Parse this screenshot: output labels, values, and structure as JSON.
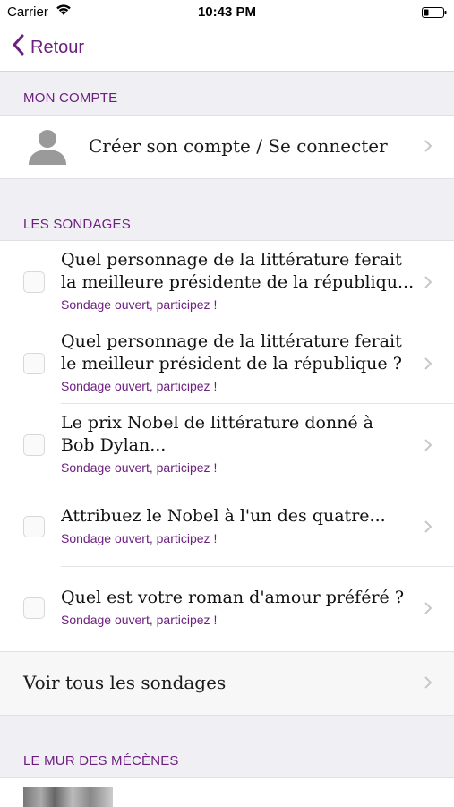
{
  "status_bar": {
    "carrier": "Carrier",
    "time": "10:43 PM",
    "wifi_icon": "wifi-icon",
    "battery_icon": "battery-icon"
  },
  "nav": {
    "back_label": "Retour",
    "back_icon": "chevron-left-icon"
  },
  "account_section": {
    "header": "MON COMPTE",
    "row_label": "Créer son compte / Se connecter",
    "avatar_icon": "user-silhouette-icon"
  },
  "polls_section": {
    "header": "LES SONDAGES",
    "items": [
      {
        "title_lines": [
          "Quel personnage de la littérature ferait",
          "la meilleure présidente de la républiqu..."
        ],
        "status": "Sondage ouvert, participez !"
      },
      {
        "title_lines": [
          "Quel personnage de la littérature ferait",
          "le meilleur président de la république ?"
        ],
        "status": "Sondage ouvert, participez !"
      },
      {
        "title_lines": [
          "Le prix Nobel de littérature donné à",
          "Bob Dylan..."
        ],
        "status": "Sondage ouvert, participez !"
      },
      {
        "title_lines": [
          "Attribuez le Nobel à l'un des quatre..."
        ],
        "status": "Sondage ouvert, participez !"
      },
      {
        "title_lines": [
          "Quel est votre roman d'amour préféré ?"
        ],
        "status": "Sondage ouvert, participez !"
      }
    ],
    "see_all_label": "Voir tous les sondages"
  },
  "sponsors_section": {
    "header": "LE MUR DES MÉCÈNES"
  },
  "colors": {
    "accent": "#6d1f80",
    "background": "#efeff4",
    "cell": "#ffffff",
    "chevron": "#c7c7cc"
  }
}
